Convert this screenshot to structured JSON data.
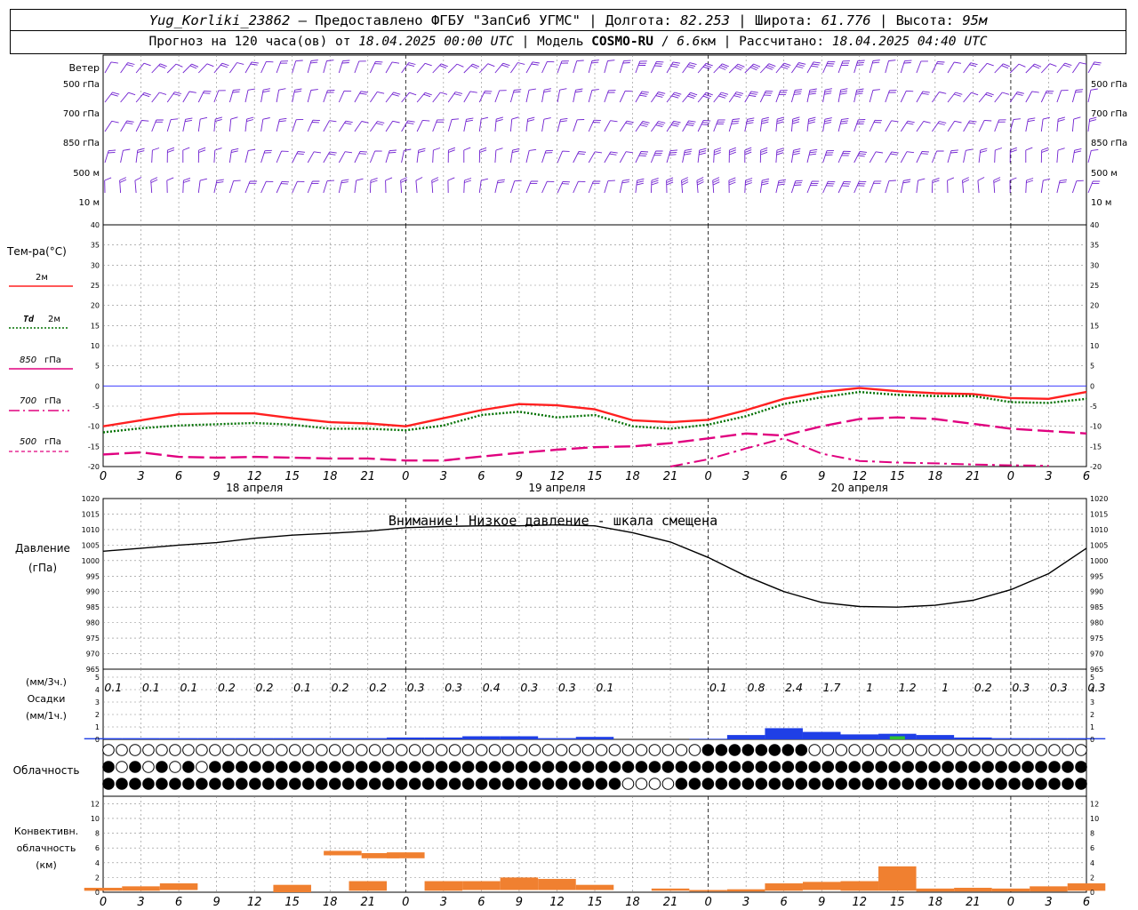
{
  "header": {
    "station": "Yug_Korliki_23862",
    "provider": "– Предоставлено ФГБУ \"ЗапСиб УГМС\"",
    "lon_label": "Долгота:",
    "lon": "82.253",
    "lat_label": "Широта:",
    "lat": "61.776",
    "alt_label": "Высота:",
    "alt": "95м",
    "forecast_label": "Прогноз на 120 часа(ов) от",
    "forecast_start": "18.04.2025 00:00 UTC",
    "model_label": "Модель",
    "model": "COSMO-RU",
    "resolution": "6.6",
    "resolution_unit": "км",
    "calc_label": "Рассчитано:",
    "calc_time": "18.04.2025 04:40 UTC"
  },
  "hour_labels": [
    "0",
    "3",
    "6",
    "9",
    "12",
    "15",
    "18",
    "21",
    "0",
    "3",
    "6",
    "9",
    "12",
    "15",
    "18",
    "21",
    "0",
    "3",
    "6",
    "9",
    "12",
    "15",
    "18",
    "21",
    "0",
    "3",
    "6"
  ],
  "date_labels": [
    "18 апреля",
    "19 апреля",
    "20 апреля"
  ],
  "colors": {
    "t2m": "#ff2020",
    "td2m": "#007000",
    "t850": "#e0007f",
    "t700": "#e0007f",
    "t500": "#e0007f",
    "wind": "#7020d0",
    "zero": "#2020ff",
    "precip": "#1f3fe6",
    "precip_green": "#30c030",
    "conv": "#f08030",
    "grid": "#888888"
  },
  "wind_panel": {
    "title": "Ветер",
    "levels": [
      "500 гПа",
      "700 гПа",
      "850 гПа",
      "500 м",
      "10 м"
    ]
  },
  "temp_panel": {
    "title": "Тем-ра(°С)",
    "legend": [
      {
        "label": "2м",
        "style": "solid"
      },
      {
        "label_italic": "Td",
        "label": "2м",
        "style": "dotted"
      },
      {
        "label_italic": "850",
        "label": "гПа",
        "style": "solid"
      },
      {
        "label_italic": "700",
        "label": "гПа",
        "style": "dashdot"
      },
      {
        "label_italic": "500",
        "label": "гПа",
        "style": "dashed"
      }
    ],
    "ticks": [
      "40",
      "35",
      "30",
      "25",
      "20",
      "15",
      "10",
      "5",
      "0",
      "-5",
      "-10",
      "-15",
      "-20"
    ]
  },
  "pressure_panel": {
    "title1": "Давление",
    "title2": "(гПа)",
    "warning": "Внимание! Низкое давление - шкала смещена",
    "ticks": [
      "1020",
      "1015",
      "1010",
      "1005",
      "1000",
      "995",
      "990",
      "985",
      "980",
      "975",
      "970",
      "965"
    ]
  },
  "precip_panel": {
    "unit3h": "(мм/3ч.)",
    "title": "Осадки",
    "unit1h": "(мм/1ч.)",
    "ticks": [
      "5",
      "4",
      "3",
      "2",
      "1",
      "0"
    ],
    "totals3h": [
      "0.1",
      "0.1",
      "0.1",
      "0.2",
      "0.2",
      "0.1",
      "0.2",
      "0.2",
      "0.3",
      "0.3",
      "0.4",
      "0.3",
      "0.3",
      "0.1",
      "",
      "",
      "0.1",
      "0.8",
      "2.4",
      "1.7",
      "1",
      "1.2",
      "1",
      "0.2",
      "0.3",
      "0.3",
      "0.3"
    ]
  },
  "cloud_panel": {
    "title": "Облачность"
  },
  "conv_panel": {
    "title1": "Конвективн.",
    "title2": "облачность",
    "title3": "(км)",
    "ticks": [
      "12",
      "10",
      "8",
      "6",
      "4",
      "2",
      "0"
    ]
  },
  "chart_data": [
    {
      "type": "line",
      "name": "temperature",
      "x_hours": [
        0,
        3,
        6,
        9,
        12,
        15,
        18,
        21,
        24,
        27,
        30,
        33,
        36,
        39,
        42,
        45,
        48,
        51,
        54,
        57,
        60,
        63,
        66,
        69,
        72,
        75,
        78
      ],
      "ylim": [
        -20,
        40
      ],
      "series": [
        {
          "name": "2м",
          "values": [
            -10,
            -8.5,
            -7,
            -6.8,
            -6.8,
            -8,
            -9,
            -9.3,
            -10,
            -8,
            -6,
            -4.5,
            -4.8,
            -5.8,
            -8.5,
            -9,
            -8.4,
            -6,
            -3.2,
            -1.5,
            -0.5,
            -1.3,
            -1.8,
            -2,
            -3,
            -3.2,
            -1.5
          ]
        },
        {
          "name": "Td 2м",
          "values": [
            -11.5,
            -10.5,
            -9.8,
            -9.5,
            -9.2,
            -9.6,
            -10.6,
            -10.6,
            -11,
            -9.8,
            -7.2,
            -6.4,
            -7.8,
            -7.2,
            -10,
            -10.6,
            -9.6,
            -7.5,
            -4.5,
            -2.8,
            -1.5,
            -2.2,
            -2.5,
            -2.5,
            -4,
            -4.2,
            -3.2
          ]
        },
        {
          "name": "850 гПа",
          "values": [
            -17,
            -16.5,
            -17.6,
            -17.8,
            -17.6,
            -17.8,
            -18,
            -18,
            -18.5,
            -18.5,
            -17.5,
            -16.6,
            -15.8,
            -15.2,
            -15,
            -14.2,
            -13,
            -11.8,
            -12.3,
            -10,
            -8.2,
            -7.8,
            -8.2,
            -9.4,
            -10.6,
            -11.2,
            -11.8
          ]
        },
        {
          "name": "700 гПа",
          "values": [
            null,
            null,
            null,
            null,
            null,
            null,
            null,
            null,
            null,
            null,
            null,
            null,
            null,
            null,
            null,
            -20.2,
            -18.2,
            -15.5,
            -13,
            -16.8,
            -18.6,
            -19,
            -19.2,
            -19.5,
            -19.7,
            -19.8,
            null
          ]
        },
        {
          "name": "500 гПа",
          "values": [
            null,
            null,
            null,
            null,
            null,
            null,
            null,
            null,
            null,
            null,
            null,
            null,
            null,
            null,
            null,
            null,
            null,
            null,
            null,
            null,
            null,
            null,
            null,
            null,
            null,
            null,
            null
          ]
        }
      ]
    },
    {
      "type": "line",
      "name": "pressure",
      "x_hours": [
        0,
        3,
        6,
        9,
        12,
        15,
        18,
        21,
        24,
        27,
        30,
        33,
        36,
        39,
        42,
        45,
        48,
        51,
        54,
        57,
        60,
        63,
        66,
        69,
        72,
        75,
        78
      ],
      "ylim": [
        965,
        1020
      ],
      "values": [
        1003,
        1004,
        1005,
        1005.8,
        1007.2,
        1008.2,
        1008.8,
        1009.5,
        1010.6,
        1011,
        1011.2,
        1011.2,
        1011.5,
        1011.2,
        1009,
        1006,
        1001,
        995,
        990,
        986.5,
        985.2,
        985,
        985.6,
        987.2,
        990.6,
        995.8,
        1004
      ]
    },
    {
      "type": "bar",
      "name": "precipitation_1h",
      "x_hours": [
        0,
        3,
        6,
        9,
        12,
        15,
        18,
        21,
        24,
        27,
        30,
        33,
        36,
        39,
        42,
        45,
        48,
        51,
        54,
        57,
        60,
        63,
        66,
        69,
        72,
        75,
        78
      ],
      "ylim": [
        0,
        5
      ],
      "values": [
        0.1,
        0.1,
        0.1,
        0.1,
        0.1,
        0.1,
        0.1,
        0.1,
        0.15,
        0.15,
        0.25,
        0.25,
        0.1,
        0.2,
        0,
        0,
        0.05,
        0.35,
        0.9,
        0.6,
        0.4,
        0.45,
        0.35,
        0.15,
        0.1,
        0.1,
        0.1
      ],
      "snow_mix": [
        0,
        0,
        0,
        0,
        0,
        0,
        0,
        0,
        0,
        0,
        0,
        0,
        0,
        0,
        0,
        0,
        0,
        0,
        0,
        0,
        0,
        0.25,
        0,
        0,
        0,
        0,
        0
      ]
    },
    {
      "type": "bar",
      "name": "convective_cloud",
      "x_hours": [
        0,
        3,
        6,
        9,
        12,
        15,
        18,
        21,
        24,
        27,
        30,
        33,
        36,
        39,
        42,
        45,
        48,
        51,
        54,
        57,
        60,
        63,
        66,
        69,
        72,
        75,
        78
      ],
      "ylim": [
        0,
        13
      ],
      "values": [
        0.6,
        0.8,
        1.2,
        0,
        0,
        1,
        0,
        1.5,
        0,
        1.5,
        1.5,
        2,
        1.8,
        1,
        0,
        0.5,
        0.3,
        0.4,
        1.2,
        1.4,
        1.5,
        3.5,
        0.5,
        0.6,
        0.5,
        0.8,
        1.2
      ],
      "base": [
        0.2,
        0.2,
        0.3,
        0,
        0,
        0,
        0,
        0.2,
        0,
        0.2,
        0.3,
        0.3,
        0.3,
        0.3,
        0,
        0.2,
        0.1,
        0.1,
        0.2,
        0.3,
        0.2,
        0.2,
        0.1,
        0.1,
        0.1,
        0.1,
        0.2
      ],
      "elevated": [
        {
          "x": 19,
          "bottom": 5,
          "top": 5.6
        },
        {
          "x": 22,
          "bottom": 4.6,
          "top": 5.3
        },
        {
          "x": 24,
          "bottom": 4.6,
          "top": 5.4
        }
      ]
    }
  ]
}
